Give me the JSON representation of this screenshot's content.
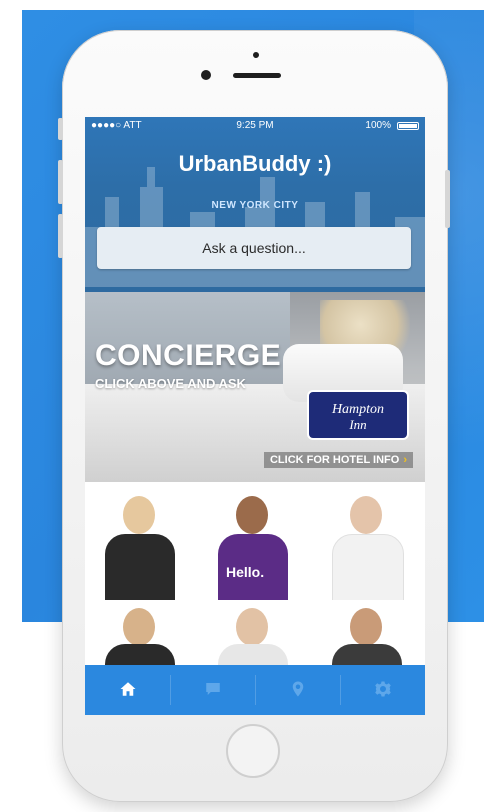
{
  "status_bar": {
    "carrier": "●●●●○ ATT",
    "time": "9:25 PM",
    "battery": "100%"
  },
  "app": {
    "title": "UrbanBuddy :)",
    "city": "NEW YORK CITY"
  },
  "search": {
    "placeholder": "Ask a question..."
  },
  "banner": {
    "headline": "CONCIERGE",
    "subheadline": "CLICK ABOVE AND ASK",
    "hotel_logo_line1": "Hampton",
    "hotel_logo_line2": "Inn",
    "hotel_cta": "CLICK FOR HOTEL INFO"
  },
  "people_grid": {
    "tile3_text": "Hello."
  },
  "tabbar": {
    "tabs": [
      {
        "name": "home",
        "icon": "home-icon",
        "active": true
      },
      {
        "name": "messages",
        "icon": "chat-icon",
        "active": false
      },
      {
        "name": "map",
        "icon": "location-pin-icon",
        "active": false
      },
      {
        "name": "settings",
        "icon": "gear-icon",
        "active": false
      }
    ]
  },
  "colors": {
    "brand_blue": "#2b88df",
    "header_blue": "#2f76b8",
    "hampton_navy": "#1e2b78",
    "cta_arrow": "#f2c21a"
  }
}
